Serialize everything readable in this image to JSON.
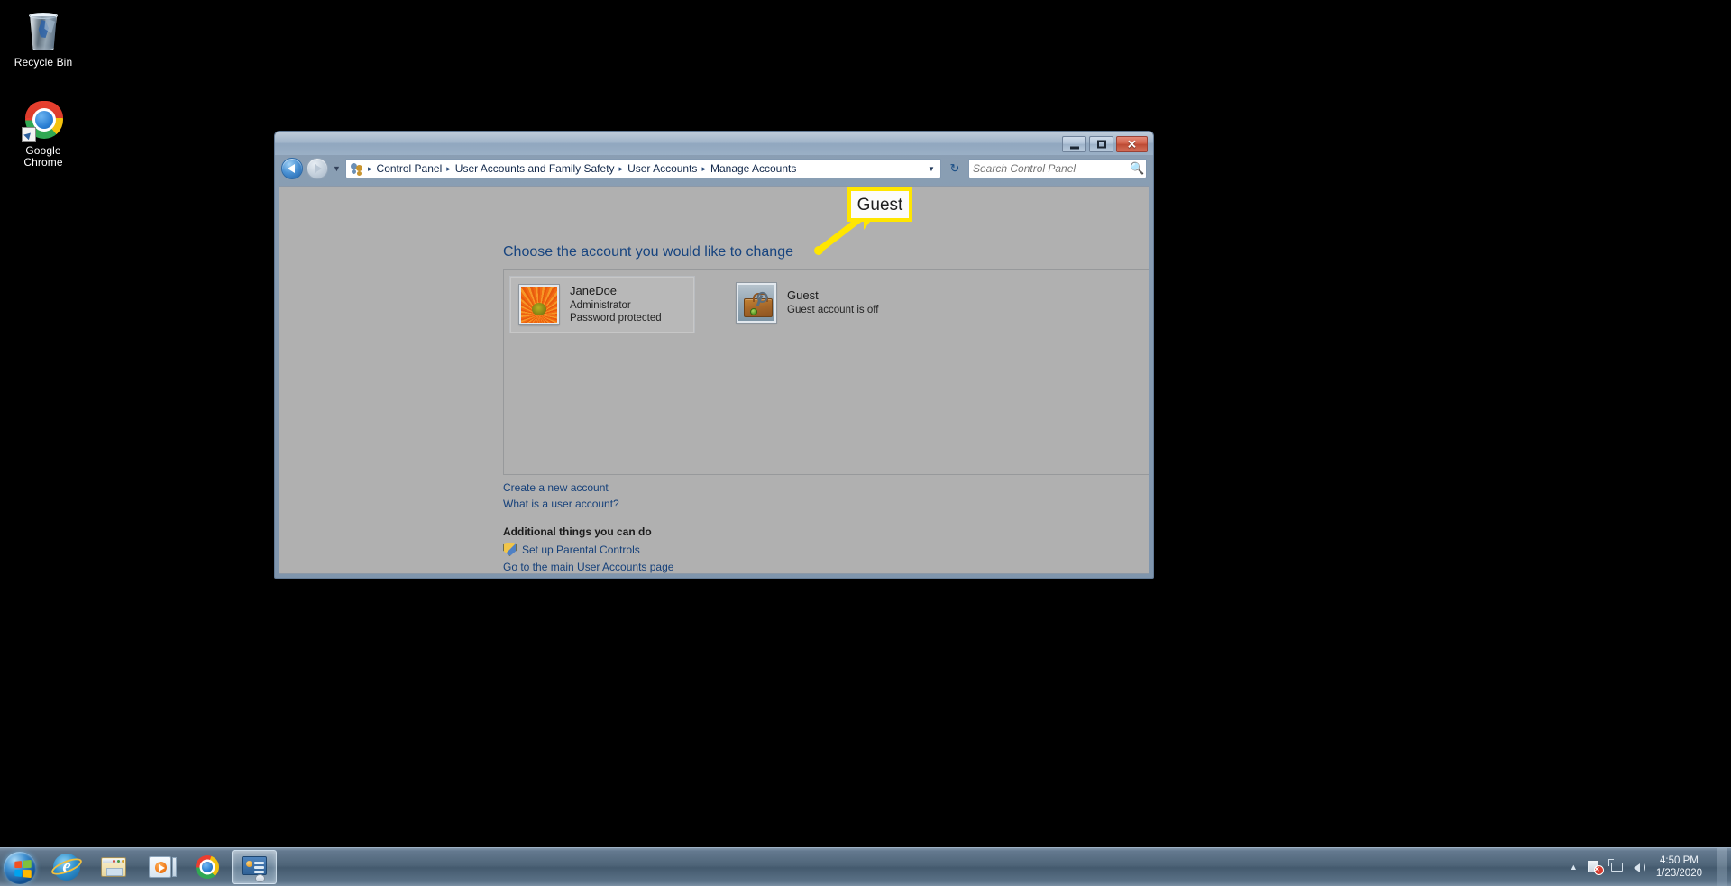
{
  "desktop": {
    "icons": [
      {
        "label": "Recycle Bin",
        "icon": "recycle-bin-icon"
      },
      {
        "label": "Google\nChrome",
        "label_line1": "Google",
        "label_line2": "Chrome",
        "icon": "google-chrome-icon"
      }
    ]
  },
  "window": {
    "title": "",
    "controls": {
      "minimize": "—",
      "maximize": "□",
      "close": "✕"
    },
    "nav": {
      "back_tooltip": "Back",
      "forward_tooltip": "Forward",
      "recent_pages": "▼",
      "refresh": "↻",
      "address_dropdown": "▼"
    },
    "breadcrumbs": [
      "Control Panel",
      "User Accounts and Family Safety",
      "User Accounts",
      "Manage Accounts"
    ],
    "breadcrumb_separator": "▸",
    "search": {
      "placeholder": "Search Control Panel",
      "value": "",
      "icon": "search-icon"
    }
  },
  "main": {
    "heading": "Choose the account you would like to change",
    "accounts": [
      {
        "name": "JaneDoe",
        "role": "Administrator",
        "status": "Password protected",
        "avatar": "sunflower-avatar",
        "selected": true
      },
      {
        "name": "Guest",
        "role": "",
        "status": "Guest account is off",
        "avatar": "suitcase-avatar",
        "selected": false
      }
    ],
    "links": [
      {
        "label": "Create a new account"
      },
      {
        "label": "What is a user account?"
      }
    ],
    "additional_heading": "Additional things you can do",
    "additional_links": [
      {
        "label": "Set up Parental Controls",
        "icon": "shield-icon"
      },
      {
        "label": "Go to the main User Accounts page",
        "icon": ""
      }
    ]
  },
  "annotation": {
    "callout_label": "Guest",
    "border_color": "#ffe600",
    "line_color": "#ffe600"
  },
  "taskbar": {
    "start": {
      "label": "Start",
      "icon": "windows-start-orb"
    },
    "items": [
      {
        "icon": "internet-explorer-icon",
        "label": "Internet Explorer",
        "active": false
      },
      {
        "icon": "windows-explorer-icon",
        "label": "Windows Explorer",
        "active": false
      },
      {
        "icon": "windows-media-player-icon",
        "label": "Windows Media Player",
        "active": false
      },
      {
        "icon": "google-chrome-icon",
        "label": "Google Chrome",
        "active": false
      },
      {
        "icon": "control-panel-icon",
        "label": "Manage Accounts",
        "active": true
      }
    ],
    "tray": {
      "chevron": "▲",
      "icons": [
        {
          "icon": "action-center-flag-icon",
          "badge": "✕"
        },
        {
          "icon": "network-icon"
        },
        {
          "icon": "volume-icon"
        }
      ],
      "time": "4:50 PM",
      "date": "1/23/2020"
    }
  }
}
